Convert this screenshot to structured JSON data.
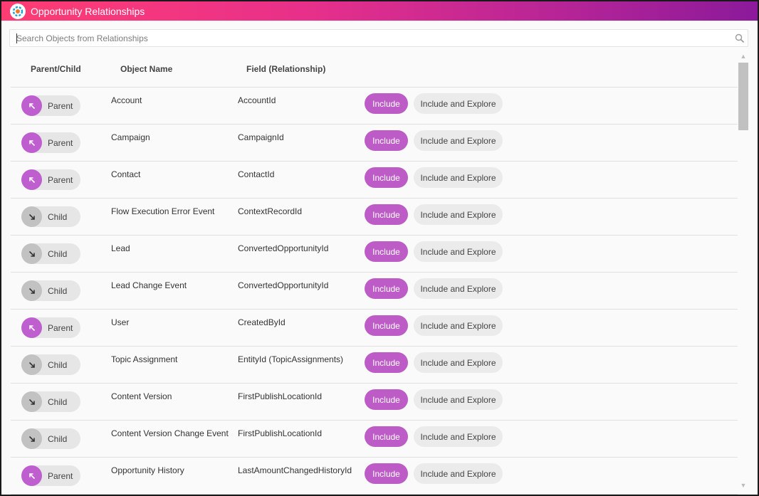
{
  "window": {
    "title": "Opportunity Relationships"
  },
  "search": {
    "placeholder": "Search Objects from Relationships",
    "value": ""
  },
  "columns": {
    "parent_child": "Parent/Child",
    "object_name": "Object Name",
    "field": "Field (Relationship)"
  },
  "buttons": {
    "include": "Include",
    "include_explore": "Include and Explore"
  },
  "rows": [
    {
      "type": "Parent",
      "object": "Account",
      "field": "AccountId"
    },
    {
      "type": "Parent",
      "object": "Campaign",
      "field": "CampaignId"
    },
    {
      "type": "Parent",
      "object": "Contact",
      "field": "ContactId"
    },
    {
      "type": "Child",
      "object": "Flow Execution Error Event",
      "field": "ContextRecordId"
    },
    {
      "type": "Child",
      "object": "Lead",
      "field": "ConvertedOpportunityId"
    },
    {
      "type": "Child",
      "object": "Lead Change Event",
      "field": "ConvertedOpportunityId"
    },
    {
      "type": "Parent",
      "object": "User",
      "field": "CreatedById"
    },
    {
      "type": "Child",
      "object": "Topic Assignment",
      "field": "EntityId (TopicAssignments)"
    },
    {
      "type": "Child",
      "object": "Content Version",
      "field": "FirstPublishLocationId"
    },
    {
      "type": "Child",
      "object": "Content Version Change Event",
      "field": "FirstPublishLocationId"
    },
    {
      "type": "Parent",
      "object": "Opportunity History",
      "field": "LastAmountChangedHistoryId"
    }
  ],
  "colors": {
    "accent": "#bd5cc6",
    "parent_dot": "#bf5fcf",
    "child_dot": "#c2c2c2"
  },
  "icons": {
    "logo": "cloud-logo-icon",
    "search": "search-icon",
    "parent": "arrow-up-left-icon",
    "child": "arrow-down-right-icon"
  }
}
